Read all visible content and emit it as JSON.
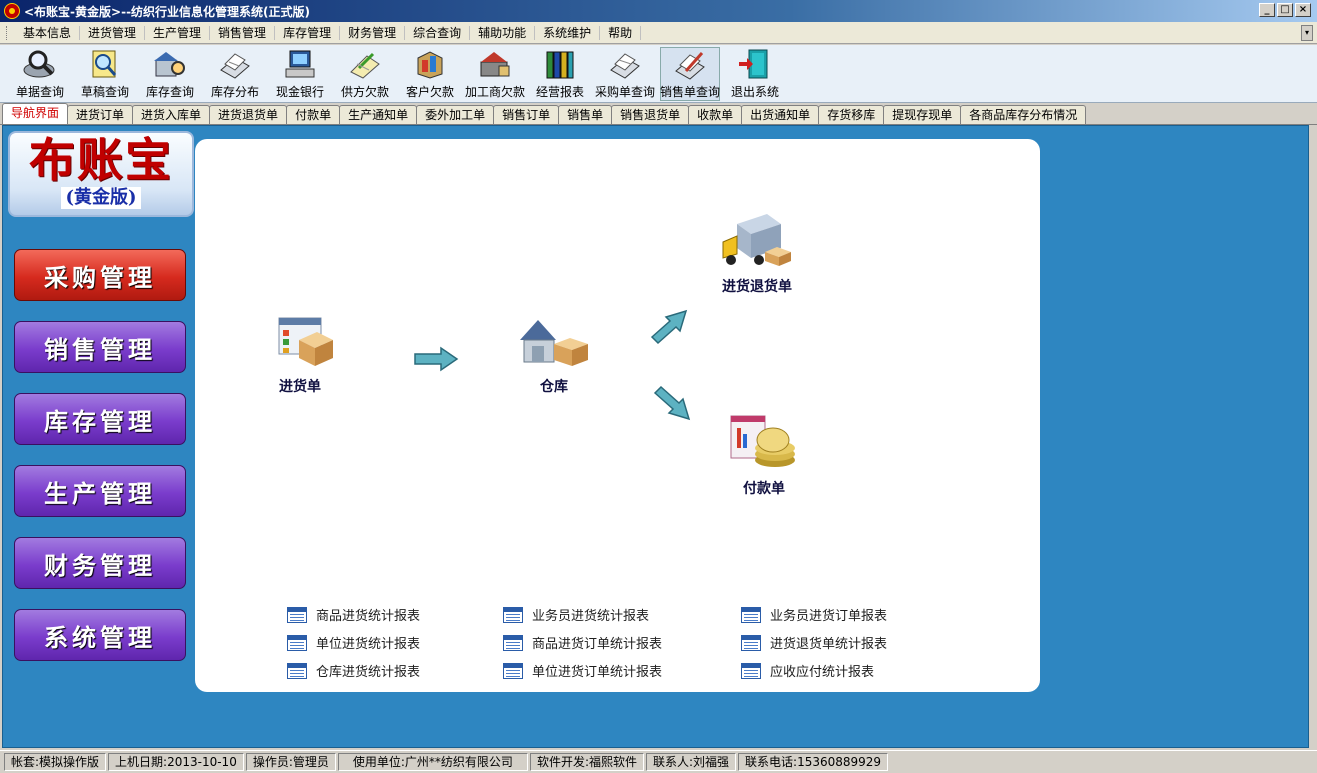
{
  "window": {
    "title": "<布账宝-黄金版>--纺织行业信息化管理系统(正式版)"
  },
  "menu": [
    "基本信息",
    "进货管理",
    "生产管理",
    "销售管理",
    "库存管理",
    "财务管理",
    "综合查询",
    "辅助功能",
    "系统维护",
    "帮助"
  ],
  "toolbar": [
    {
      "label": "单据查询",
      "icon": "magnifier-icon"
    },
    {
      "label": "草稿查询",
      "icon": "search-doc-icon"
    },
    {
      "label": "库存查询",
      "icon": "warehouse-search-icon"
    },
    {
      "label": "库存分布",
      "icon": "distribution-icon"
    },
    {
      "label": "现金银行",
      "icon": "cash-bank-icon"
    },
    {
      "label": "供方欠款",
      "icon": "supplier-debt-icon"
    },
    {
      "label": "客户欠款",
      "icon": "customer-debt-icon"
    },
    {
      "label": "加工商欠款",
      "icon": "processor-debt-icon"
    },
    {
      "label": "经营报表",
      "icon": "books-icon"
    },
    {
      "label": "采购单查询",
      "icon": "purchase-query-icon"
    },
    {
      "label": "销售单查询",
      "icon": "sales-query-icon"
    },
    {
      "label": "退出系统",
      "icon": "exit-door-icon"
    }
  ],
  "tabs": [
    "导航界面",
    "进货订单",
    "进货入库单",
    "进货退货单",
    "付款单",
    "生产通知单",
    "委外加工单",
    "销售订单",
    "销售单",
    "销售退货单",
    "收款单",
    "出货通知单",
    "存货移库",
    "提现存现单",
    "各商品库存分布情况"
  ],
  "logo": {
    "main": "布账宝",
    "sub": "(黄金版)"
  },
  "sidebar": [
    "采购管理",
    "销售管理",
    "库存管理",
    "生产管理",
    "财务管理",
    "系统管理"
  ],
  "flow": {
    "purchase": "进货单",
    "warehouse": "仓库",
    "return": "进货退货单",
    "payment": "付款单"
  },
  "reports": {
    "col1": [
      "商品进货统计报表",
      "单位进货统计报表",
      "仓库进货统计报表"
    ],
    "col2": [
      "业务员进货统计报表",
      "商品进货订单统计报表",
      "单位进货订单统计报表"
    ],
    "col3": [
      "业务员进货订单报表",
      "进货退货单统计报表",
      "应收应付统计报表"
    ]
  },
  "status": {
    "account": "帐套:模拟操作版",
    "login_date": "上机日期:2013-10-10",
    "operator": "操作员:管理员",
    "company": "使用单位:广州**纺织有限公司",
    "developer": "软件开发:福熙软件",
    "contact": "联系人:刘福强",
    "phone": "联系电话:15360889929"
  }
}
